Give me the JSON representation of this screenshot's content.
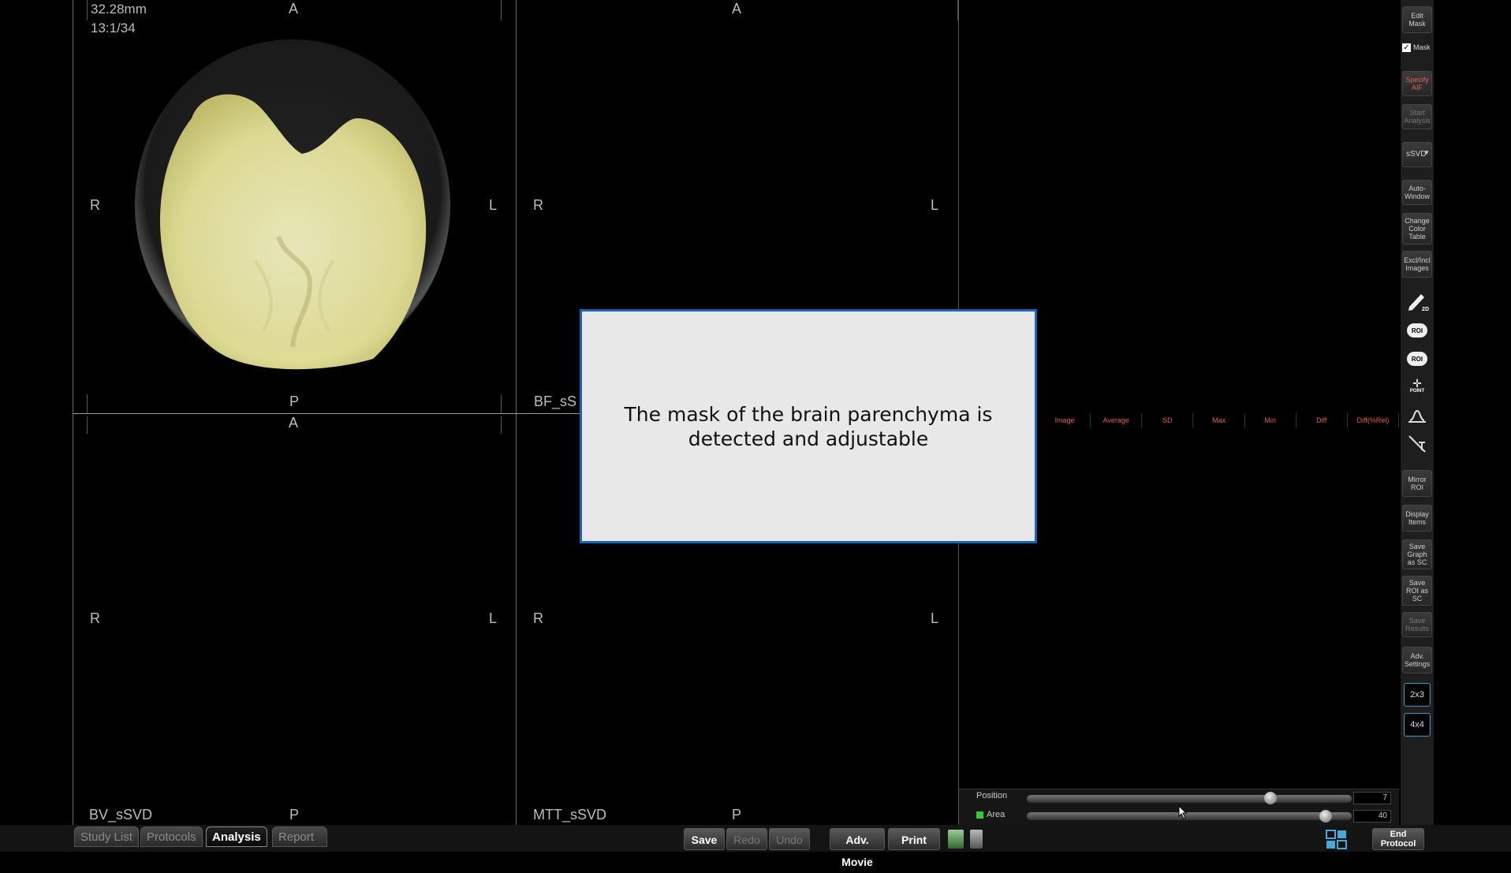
{
  "viewports": {
    "top_left": {
      "info_line1": "32.28mm",
      "info_line2": "13:1/34",
      "top": "A",
      "bottom": "P",
      "left": "R",
      "right": "L"
    },
    "top_right": {
      "top": "A",
      "left": "R",
      "right": "L",
      "series": "BF_sS"
    },
    "bottom_left": {
      "top": "A",
      "bottom": "P",
      "left": "R",
      "right": "L",
      "series": "BV_sSVD"
    },
    "bottom_right": {
      "bottom": "P",
      "left": "R",
      "right": "L",
      "series": "MTT_sSVD"
    }
  },
  "graph": {
    "columns": [
      "Image",
      "Average",
      "SD",
      "Max",
      "Min",
      "Diff",
      "Diff(%Rel)"
    ]
  },
  "toolbar": {
    "edit_mask": "Edit Mask",
    "mask_label": "Mask",
    "mask_checked": true,
    "specify_aif": "Specify AIF",
    "start_analysis": "Start Analysis",
    "method": "sSVD",
    "auto_window": "Auto-Window",
    "change_color_table": "Change Color Table",
    "excl_incl_images": "Excl/Incl Images",
    "pen_2d": "2D",
    "roi1": "ROI",
    "roi2": "ROI",
    "point": "POINT",
    "mirror_roi": "Mirror ROI",
    "display_items": "Display Items",
    "save_graph": "Save Graph as SC",
    "save_roi": "Save ROI as SC",
    "save_results": "Save Results",
    "adv_settings": "Adv. Settings",
    "layout_2x3": "2x3",
    "layout_4x4": "4x4"
  },
  "sliders": {
    "position_label": "Position",
    "position_value": "7",
    "position_fraction": 0.75,
    "area_label": "Area",
    "area_value": "40",
    "area_fraction": 0.92
  },
  "bottom": {
    "tabs": [
      "Study List",
      "Protocols",
      "Analysis",
      "Report"
    ],
    "active_tab": "Analysis",
    "save": "Save",
    "redo": "Redo",
    "undo": "Undo",
    "adv_movie": "Adv. Movie",
    "print": "Print",
    "end_protocol": "End Protocol"
  },
  "dialog": {
    "line1": "The mask of the brain parenchyma is",
    "line2": "detected and adjustable"
  },
  "colors": {
    "dialog_border": "#1666b8",
    "mask_overlay": "#e8e6a0",
    "graph_header": "#e06040"
  }
}
